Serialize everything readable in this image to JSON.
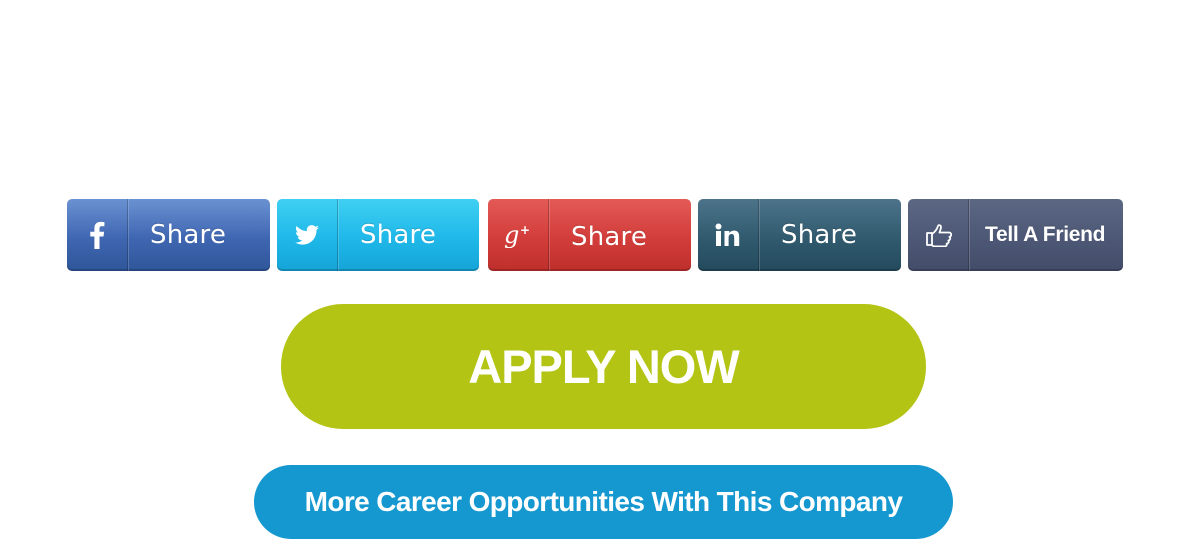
{
  "share_bar": {
    "buttons": [
      {
        "network": "facebook",
        "icon": "facebook-icon",
        "label": "Share",
        "color": "#3f66b1"
      },
      {
        "network": "twitter",
        "icon": "twitter-icon",
        "label": "Share",
        "color": "#1fb8e9"
      },
      {
        "network": "google-plus",
        "icon": "google-plus-icon",
        "label": "Share",
        "color": "#d23d3a"
      },
      {
        "network": "linkedin",
        "icon": "linkedin-icon",
        "label": "Share",
        "color": "#315a6f"
      },
      {
        "network": "tell-a-friend",
        "icon": "thumbs-up-icon",
        "label": "Tell A Friend",
        "color": "#4d5876"
      }
    ]
  },
  "actions": {
    "apply_label": "APPLY NOW",
    "apply_color": "#b3c414",
    "career_label": "More Career Opportunities With This Company",
    "career_color": "#1597cf"
  }
}
